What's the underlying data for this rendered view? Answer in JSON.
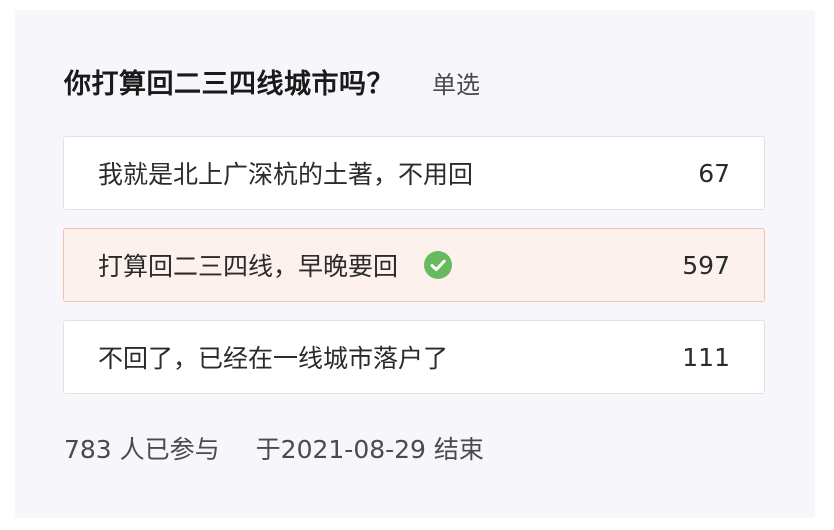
{
  "poll": {
    "question": "你打算回二三四线城市吗？",
    "type_label": "单选",
    "options": [
      {
        "label": "我就是北上广深杭的土著，不用回",
        "count": "67",
        "selected": false
      },
      {
        "label": "打算回二三四线，早晚要回",
        "count": "597",
        "selected": true
      },
      {
        "label": "不回了，已经在一线城市落户了",
        "count": "111",
        "selected": false
      }
    ],
    "footer": {
      "participants": "783 人已参与",
      "end_date": "于2021-08-29 结束"
    }
  },
  "colors": {
    "card_bg": "#f6f6fb",
    "selected_bg": "#fdf1ed",
    "selected_border": "#f5c2b1",
    "check_green": "#67bb5e"
  },
  "icons": {
    "selected_mark": "check-circle-icon"
  }
}
